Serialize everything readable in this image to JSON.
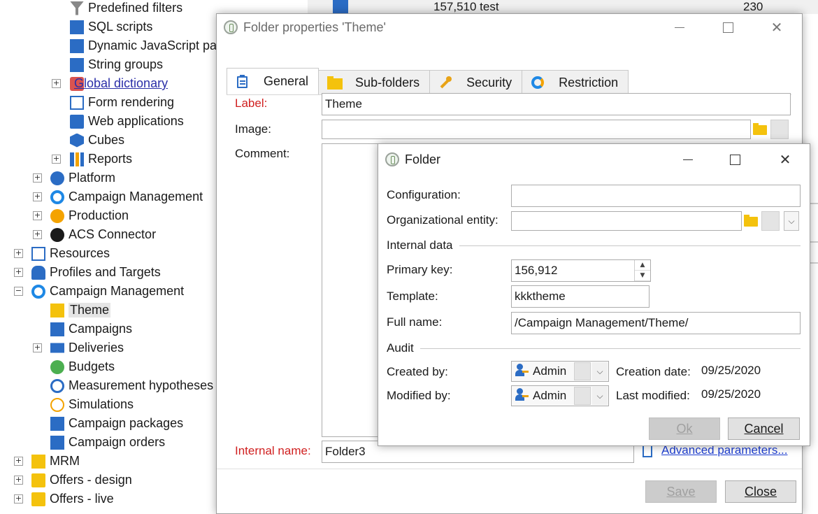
{
  "tree": {
    "items": [
      {
        "label": "Predefined filters",
        "icon": "filter-icon",
        "indent": 2,
        "expander": false
      },
      {
        "label": "SQL scripts",
        "icon": "sql-icon",
        "indent": 2,
        "expander": false
      },
      {
        "label": "Dynamic JavaScript pag",
        "icon": "js-script-icon",
        "indent": 2,
        "expander": false
      },
      {
        "label": "String groups",
        "icon": "script-icon",
        "indent": 2,
        "expander": false
      },
      {
        "label": "Global dictionary",
        "icon": "dictionary-icon",
        "indent": 2,
        "expander": true,
        "link": true
      },
      {
        "label": "Form rendering",
        "icon": "form-icon",
        "indent": 2,
        "expander": false
      },
      {
        "label": "Web applications",
        "icon": "web-app-icon",
        "indent": 2,
        "expander": false
      },
      {
        "label": "Cubes",
        "icon": "cube-icon",
        "indent": 2,
        "expander": false
      },
      {
        "label": "Reports",
        "icon": "reports-icon",
        "indent": 2,
        "expander": true
      },
      {
        "label": "Platform",
        "icon": "platform-gear-icon",
        "indent": 1,
        "expander": true
      },
      {
        "label": "Campaign Management",
        "icon": "campaign-icon",
        "indent": 1,
        "expander": true
      },
      {
        "label": "Production",
        "icon": "production-gear-icon",
        "indent": 1,
        "expander": true
      },
      {
        "label": "ACS Connector",
        "icon": "acs-icon",
        "indent": 1,
        "expander": true
      },
      {
        "label": "Resources",
        "icon": "resources-icon",
        "indent": 0,
        "expander": true
      },
      {
        "label": "Profiles and Targets",
        "icon": "profiles-icon",
        "indent": 0,
        "expander": true
      },
      {
        "label": "Campaign Management",
        "icon": "campaign-icon",
        "indent": 0,
        "expander": true,
        "expanded": true
      },
      {
        "label": "Theme",
        "icon": "folder-icon",
        "indent": 1,
        "expander": false,
        "selected": true
      },
      {
        "label": "Campaigns",
        "icon": "campaigns-icon",
        "indent": 1,
        "expander": false
      },
      {
        "label": "Deliveries",
        "icon": "deliveries-icon",
        "indent": 1,
        "expander": true
      },
      {
        "label": "Budgets",
        "icon": "budget-icon",
        "indent": 1,
        "expander": false
      },
      {
        "label": "Measurement hypotheses",
        "icon": "hypothesis-icon",
        "indent": 1,
        "expander": false
      },
      {
        "label": "Simulations",
        "icon": "simulation-icon",
        "indent": 1,
        "expander": false
      },
      {
        "label": "Campaign packages",
        "icon": "package-icon",
        "indent": 1,
        "expander": false
      },
      {
        "label": "Campaign orders",
        "icon": "orders-icon",
        "indent": 1,
        "expander": false
      },
      {
        "label": "MRM",
        "icon": "mrm-icon",
        "indent": 0,
        "expander": true
      },
      {
        "label": "Offers - design",
        "icon": "offer-gift-icon",
        "indent": 0,
        "expander": true
      },
      {
        "label": "Offers - live",
        "icon": "offer-gift-icon",
        "indent": 0,
        "expander": true
      }
    ]
  },
  "background_grid": {
    "row": {
      "value": "157,510 test",
      "count": "230"
    }
  },
  "folder_properties": {
    "title": "Folder properties 'Theme'",
    "tabs": [
      {
        "label": "General",
        "icon": "clipboard-icon",
        "active": true
      },
      {
        "label": "Sub-folders",
        "icon": "folder-icon"
      },
      {
        "label": "Security",
        "icon": "key-icon"
      },
      {
        "label": "Restriction",
        "icon": "restriction-icon"
      }
    ],
    "label_caption": "Label:",
    "label_value": "Theme",
    "image_caption": "Image:",
    "image_value": "",
    "comment_caption": "Comment:",
    "comment_value": "",
    "internal_name_caption": "Internal name:",
    "internal_name_value": "Folder3",
    "advanced_link": "Advanced parameters...",
    "save_label": "Save",
    "close_label": "Close"
  },
  "folder_dialog": {
    "title": "Folder",
    "configuration_caption": "Configuration:",
    "configuration_value": "",
    "org_entity_caption": "Organizational entity:",
    "org_entity_value": "",
    "internal_data_header": "Internal data",
    "primary_key_caption": "Primary key:",
    "primary_key_value": "156,912",
    "template_caption": "Template:",
    "template_value": "kkktheme",
    "full_name_caption": "Full name:",
    "full_name_value": "/Campaign Management/Theme/",
    "audit_header": "Audit",
    "created_by_caption": "Created by:",
    "created_by_value": "Admin",
    "creation_date_caption": "Creation date:",
    "creation_date_value": "09/25/2020",
    "modified_by_caption": "Modified by:",
    "modified_by_value": "Admin",
    "last_modified_caption": "Last modified:",
    "last_modified_value": "09/25/2020",
    "ok_label": "Ok",
    "cancel_label": "Cancel"
  },
  "colors": {
    "required_label": "#d02020",
    "link": "#1f3fd1",
    "folder": "#f4c20d",
    "campaign_blue": "#1e88e5"
  }
}
